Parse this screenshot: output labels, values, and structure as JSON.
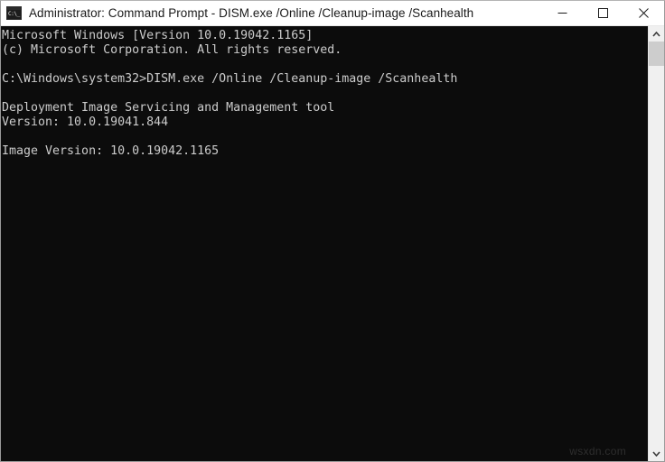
{
  "window": {
    "title": "Administrator: Command Prompt - DISM.exe  /Online /Cleanup-image /Scanhealth",
    "icon": "console-window-icon",
    "icon_glyph": "C:\\_",
    "controls": {
      "minimize_label": "Minimize",
      "maximize_label": "Maximize",
      "close_label": "Close"
    },
    "titlebar_bg": "#ffffff",
    "titlebar_fg": "#1a1a1a"
  },
  "console": {
    "background": "#0c0c0c",
    "foreground": "#cccccc",
    "lines": [
      "Microsoft Windows [Version 10.0.19042.1165]",
      "(c) Microsoft Corporation. All rights reserved.",
      "",
      "C:\\Windows\\system32>DISM.exe /Online /Cleanup-image /Scanhealth",
      "",
      "Deployment Image Servicing and Management tool",
      "Version: 10.0.19041.844",
      "",
      "Image Version: 10.0.19042.1165"
    ],
    "text": "Microsoft Windows [Version 10.0.19042.1165]\n(c) Microsoft Corporation. All rights reserved.\n\nC:\\Windows\\system32>DISM.exe /Online /Cleanup-image /Scanhealth\n\nDeployment Image Servicing and Management tool\nVersion: 10.0.19041.844\n\nImage Version: 10.0.19042.1165"
  },
  "scrollbar": {
    "up_arrow": "chevron-up-icon",
    "down_arrow": "chevron-down-icon",
    "thumb_color": "#cdcdcd",
    "track_color": "#f0f0f0"
  },
  "watermark": {
    "text": "wsxdn.com"
  }
}
